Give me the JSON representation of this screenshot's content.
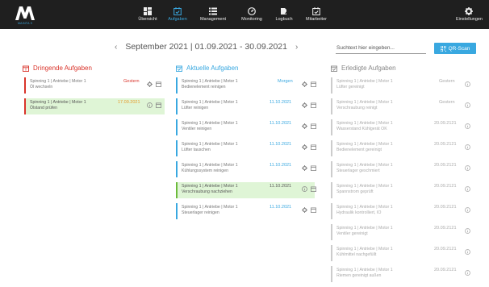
{
  "app": {
    "logo_text": "MAINTA 9",
    "nav": [
      {
        "label": "Übersicht",
        "icon": "dashboard-icon"
      },
      {
        "label": "Aufgaben",
        "icon": "calendar-check-icon",
        "active": true
      },
      {
        "label": "Management",
        "icon": "list-icon"
      },
      {
        "label": "Monitoring",
        "icon": "gauge-icon"
      },
      {
        "label": "Logbuch",
        "icon": "book-pen-icon"
      },
      {
        "label": "Mitarbeiter",
        "icon": "calendar-user-icon"
      }
    ],
    "settings_label": "Einstellungen"
  },
  "datebar": {
    "prev": "‹",
    "label": "September 2021 | 01.09.2021 - 30.09.2021",
    "next": "›",
    "search_placeholder": "Suchtext hier eingeben...",
    "qr_label": "QR-Scan"
  },
  "columns": {
    "urgent": {
      "title": "Dringende Aufgaben",
      "color": "#d9342b",
      "cards": [
        {
          "title": "Spinning 1 | Antriebe | Motor 1",
          "subtitle": "Öl wechseln",
          "date": "Gestern"
        },
        {
          "title": "Spinning 1 | Antriebe | Motor 1",
          "subtitle": "Ölstand prüfen",
          "date": "17.09.2021",
          "highlight": true
        }
      ]
    },
    "current": {
      "title": "Aktuelle Aufgaben",
      "color": "#39a8e0",
      "cards": [
        {
          "title": "Spinning 1 | Antriebe | Motor 1",
          "subtitle": "Bedienelement reinigen",
          "date": "Morgen"
        },
        {
          "title": "Spinning 1 | Antriebe | Motor 1",
          "subtitle": "Lüfter reinigen",
          "date": "11.10.2021"
        },
        {
          "title": "Spinning 1 | Antriebe | Motor 1",
          "subtitle": "Ventiler reinigen",
          "date": "11.10.2021"
        },
        {
          "title": "Spinning 1 | Antriebe | Motor 1",
          "subtitle": "Lüfter tauschen",
          "date": "11.10.2021"
        },
        {
          "title": "Spinning 1 | Antriebe | Motor 1",
          "subtitle": "Kühlungssystem reinigen",
          "date": "11.10.2021"
        },
        {
          "title": "Spinning 1 | Antriebe | Motor 1",
          "subtitle": "Verschraubung nachziehen",
          "date": "11.10.2021",
          "highlight": true
        },
        {
          "title": "Spinning 1 | Antriebe | Motor 1",
          "subtitle": "Steuerlager reinigen",
          "date": "11.10.2021"
        }
      ]
    },
    "done": {
      "title": "Erledigte Aufgaben",
      "color": "#888888",
      "cards": [
        {
          "title": "Spinning 1 | Antriebe | Motor 1",
          "subtitle": "Lüfter gereinigt",
          "date": "Gestern"
        },
        {
          "title": "Spinning 1 | Antriebe | Motor 1",
          "subtitle": "Verschraubung reinigt",
          "date": "Gestern"
        },
        {
          "title": "Spinning 1 | Antriebe | Motor 1",
          "subtitle": "Wasserstand Kühlgerät OK",
          "date": "20.09.2121"
        },
        {
          "title": "Spinning 1 | Antriebe | Motor 1",
          "subtitle": "Bedienelement gereinigt",
          "date": "20.09.2121"
        },
        {
          "title": "Spinning 1 | Antriebe | Motor 1",
          "subtitle": "Steuerlager geschmiert",
          "date": "20.09.2121"
        },
        {
          "title": "Spinning 1 | Antriebe | Motor 1",
          "subtitle": "Spannstrom geprüft",
          "date": "20.09.2121"
        },
        {
          "title": "Spinning 1 | Antriebe | Motor 1",
          "subtitle": "Hydraulik kontrolliert, IO",
          "date": "20.09.2121"
        },
        {
          "title": "Spinning 1 | Antriebe | Motor 1",
          "subtitle": "Ventiler gereinigt",
          "date": "20.09.2121"
        },
        {
          "title": "Spinning 1 | Antriebe | Motor 1",
          "subtitle": "Kühlmittel nachgefüllt",
          "date": "20.09.2121"
        },
        {
          "title": "Spinning 1 | Antriebe | Motor 1",
          "subtitle": "Riemen gereinigt außen",
          "date": "20.09.2121"
        }
      ]
    }
  }
}
